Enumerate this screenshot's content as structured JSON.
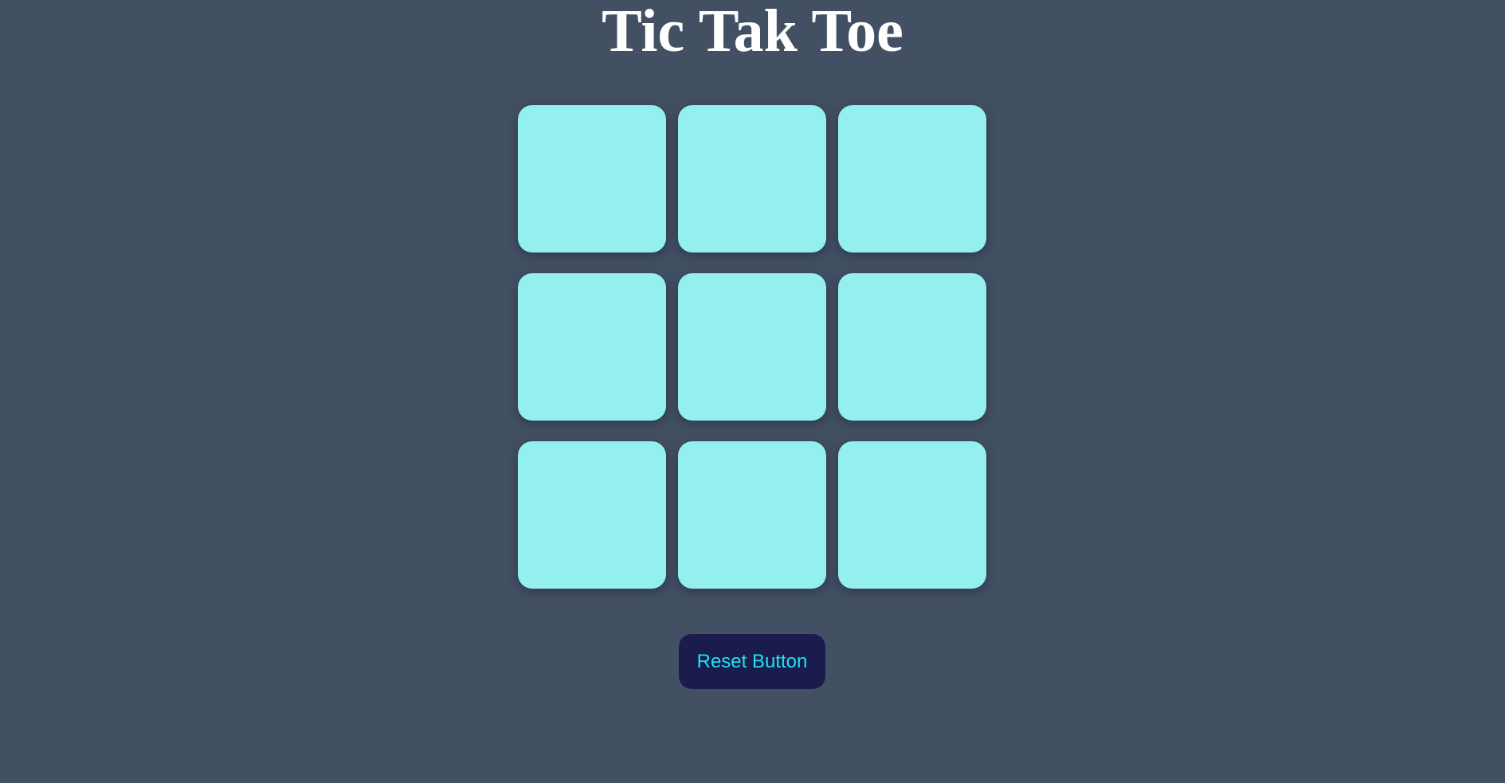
{
  "title": "Tic Tak Toe",
  "board": {
    "cells": [
      "",
      "",
      "",
      "",
      "",
      "",
      "",
      "",
      ""
    ]
  },
  "reset": {
    "label": "Reset Button"
  },
  "colors": {
    "background": "#435063",
    "cell": "#93f0ef",
    "button_bg": "#1a1c4d",
    "button_text": "#1fe3ef",
    "title": "#ffffff"
  }
}
